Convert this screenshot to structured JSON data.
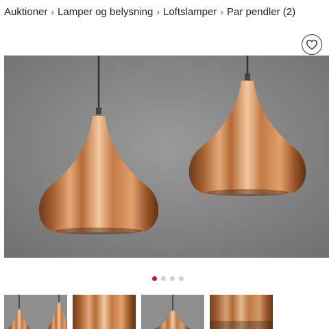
{
  "breadcrumb": {
    "items": [
      {
        "label": "Auktioner"
      },
      {
        "label": "Lamper og belysning"
      },
      {
        "label": "Loftslamper"
      },
      {
        "label": "Par pendler (2)"
      }
    ],
    "separator": "›"
  },
  "favorite": {
    "icon": "heart-icon"
  },
  "gallery": {
    "dots": 4,
    "active_dot": 0,
    "thumbnails": [
      {
        "subject": "two copper pendant lamps"
      },
      {
        "subject": "copper lamp close-up"
      },
      {
        "subject": "single copper pendant lamp"
      },
      {
        "subject": "copper surface detail"
      }
    ]
  },
  "colors": {
    "accent": "#c0143c",
    "copper": "#c47a45",
    "background_wall": "#8c8c8c"
  }
}
